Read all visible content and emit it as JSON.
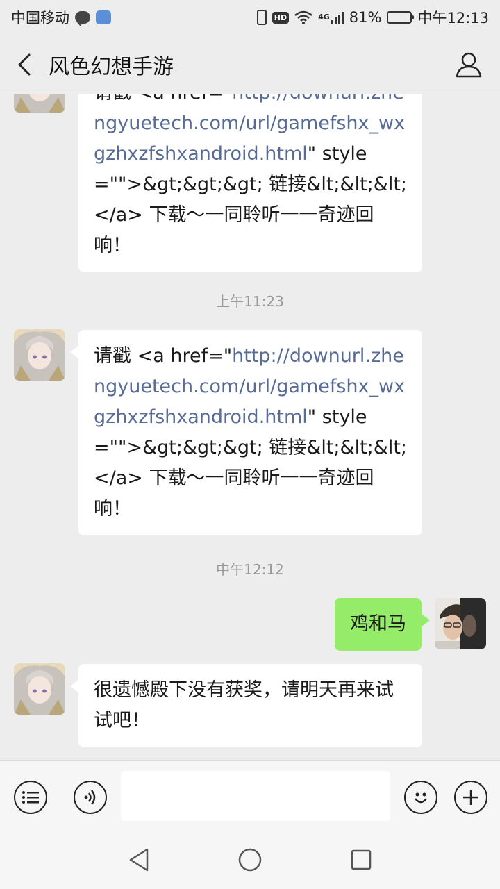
{
  "status_bar": {
    "carrier": "中国移动",
    "hd": "HD",
    "network": "4G",
    "battery": "81%",
    "battery_level": 0.81,
    "time": "中午12:13"
  },
  "header": {
    "title": "风色幻想手游"
  },
  "messages": [
    {
      "side": "left",
      "sender": "bot",
      "parts": [
        {
          "text": "请戳 <a href=\"",
          "link": false
        },
        {
          "text": "http://downurl.zhengyuetech.com/url/gamefshx_wxgzhxzfshxandroid.html",
          "link": true
        },
        {
          "text": "\" style=\"\">&gt;&gt;&gt; 链接&lt;&lt;&lt;</a> 下载～一同聆听一一奇迹回响！",
          "link": false
        }
      ]
    },
    {
      "time": "上午11:23"
    },
    {
      "side": "left",
      "sender": "bot",
      "parts": [
        {
          "text": "请戳 <a href=\"",
          "link": false
        },
        {
          "text": "http://downurl.zhengyuetech.com/url/gamefshx_wxgzhxzfshxandroid.html",
          "link": true
        },
        {
          "text": "\" style=\"\">&gt;&gt;&gt; 链接&lt;&lt;&lt;</a> 下载～一同聆听一一奇迹回响！",
          "link": false
        }
      ]
    },
    {
      "time": "中午12:12"
    },
    {
      "side": "right",
      "sender": "me",
      "text": "鸡和马"
    },
    {
      "side": "left",
      "sender": "bot",
      "text": "很遗憾殿下没有获奖，请明天再来试试吧！"
    }
  ],
  "input": {
    "value": "",
    "placeholder": ""
  },
  "colors": {
    "background": "#ededed",
    "bubble_mine": "#95ec69",
    "bubble_other": "#ffffff",
    "link": "#576b95",
    "timestamp": "#999999"
  }
}
